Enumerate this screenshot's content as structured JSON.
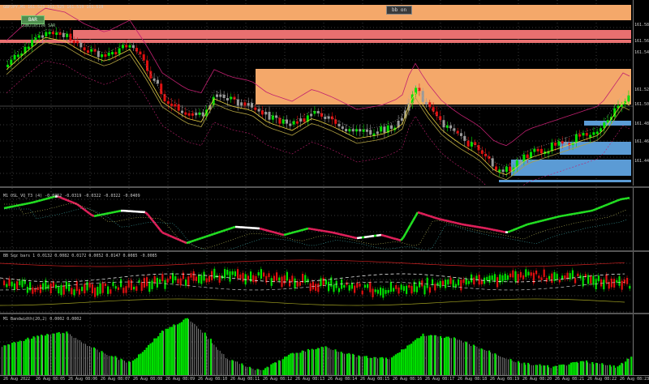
{
  "header": {
    "symbol_line": "GBPJPY,M1  161.523 161.525 161.519 161.519",
    "bb_button": "bb on",
    "bar_button": "BAR",
    "bar_sub": "Cumulative SAR"
  },
  "indicators": {
    "osc_label": "M1 OSL_VQ_T3 (4)  -0.0352 -0.0319 -0.0322 -0.0322 -0.0409",
    "bb_label": "BB Sqz bars 1  0.0132 0.0082 0.0172 0.0052 0.0147 0.0085 -0.0085",
    "bw_label": "M1 Bandwidth(20,2)  0.0002  0.0002"
  },
  "price_scale": [
    "161.58",
    "161.56",
    "161.54",
    "161.52",
    "161.50",
    "161.48",
    "161.46",
    "161.44"
  ],
  "time_axis": [
    "26 Aug 2022",
    "26 Aug 08:05",
    "26 Aug 08:06",
    "26 Aug 08:07",
    "26 Aug 08:08",
    "26 Aug 08:09",
    "26 Aug 08:10",
    "26 Aug 08:11",
    "26 Aug 08:12",
    "26 Aug 08:13",
    "26 Aug 08:14",
    "26 Aug 08:15",
    "26 Aug 08:16",
    "26 Aug 08:17",
    "26 Aug 08:18",
    "26 Aug 08:19",
    "26 Aug 08:20",
    "26 Aug 08:21",
    "26 Aug 08:22",
    "26 Aug 08:23"
  ],
  "colors": {
    "bull": "#00e000",
    "bear": "#e01010",
    "neutral": "#9a9a9a",
    "zone_orange": "#f4a86a",
    "zone_red": "#e87070",
    "zone_blue": "#5b9bd5",
    "osc_up": "#22e022",
    "osc_down": "#e0205a",
    "osc_flat": "#ffffff"
  }
}
